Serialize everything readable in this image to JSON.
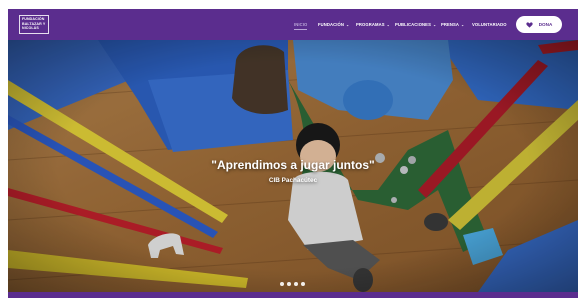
{
  "logo": {
    "lines": [
      "FUNDACIÓN",
      "BALTAZAR Y",
      "NICOLÁS"
    ]
  },
  "nav": {
    "items": [
      {
        "label": "INICIO",
        "dropdown": false,
        "active": true
      },
      {
        "label": "FUNDACIÓN",
        "dropdown": true,
        "active": false
      },
      {
        "label": "PROGRAMAS",
        "dropdown": true,
        "active": false
      },
      {
        "label": "PUBLICACIONES",
        "dropdown": true,
        "active": false
      },
      {
        "label": "PRENSA",
        "dropdown": true,
        "active": false
      },
      {
        "label": "VOLUNTARIADO",
        "dropdown": false,
        "active": false
      }
    ],
    "donate_label": "DONA"
  },
  "hero": {
    "title": "\"Aprendimos a jugar juntos\"",
    "subtitle": "CIB Pachacútec",
    "slides": 4
  },
  "colors": {
    "brand": "#5b2d8e",
    "nav_active": "#b9a4d6",
    "donate_bg": "#ffffff"
  },
  "icons": {
    "donate": "heart-icon",
    "dropdown": "chevron-down-icon"
  }
}
